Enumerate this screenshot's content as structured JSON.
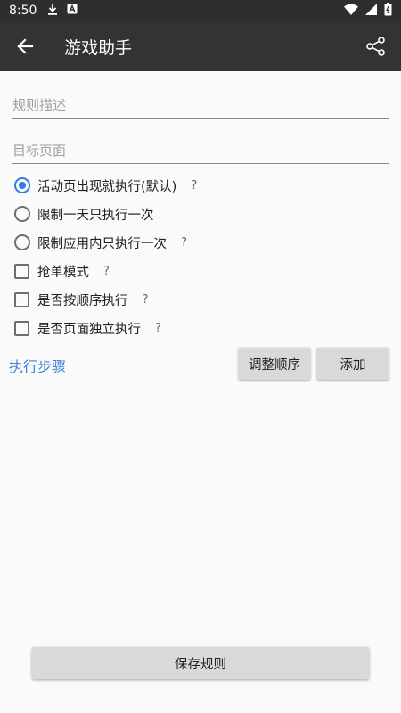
{
  "status_bar": {
    "time": "8:50",
    "icons": [
      "download-icon",
      "a-badge-icon",
      "wifi-icon",
      "signal-icon",
      "battery-icon"
    ]
  },
  "toolbar": {
    "title": "游戏助手",
    "back_icon": "arrow-back-icon",
    "share_icon": "share-icon"
  },
  "form": {
    "rule_description": {
      "value": "",
      "placeholder": "规则描述"
    },
    "target_page": {
      "value": "",
      "placeholder": "目标页面"
    }
  },
  "radio_options": [
    {
      "label": "活动页出现就执行(默认)",
      "checked": true,
      "help": "?"
    },
    {
      "label": "限制一天只执行一次",
      "checked": false,
      "help": ""
    },
    {
      "label": "限制应用内只执行一次",
      "checked": false,
      "help": "?"
    }
  ],
  "checkbox_options": [
    {
      "label": "抢单模式",
      "checked": false,
      "help": "?"
    },
    {
      "label": "是否按顺序执行",
      "checked": false,
      "help": "?"
    },
    {
      "label": "是否页面独立执行",
      "checked": false,
      "help": "?"
    }
  ],
  "steps": {
    "label": "执行步骤",
    "reorder_button": "调整顺序",
    "add_button": "添加"
  },
  "footer": {
    "save_button": "保存规则"
  },
  "colors": {
    "toolbar_bg": "#333333",
    "status_bar_bg": "#2e2e2e",
    "accent": "#2f7ee6",
    "link": "#3b7fd8",
    "button_bg": "#d9d9d9"
  }
}
